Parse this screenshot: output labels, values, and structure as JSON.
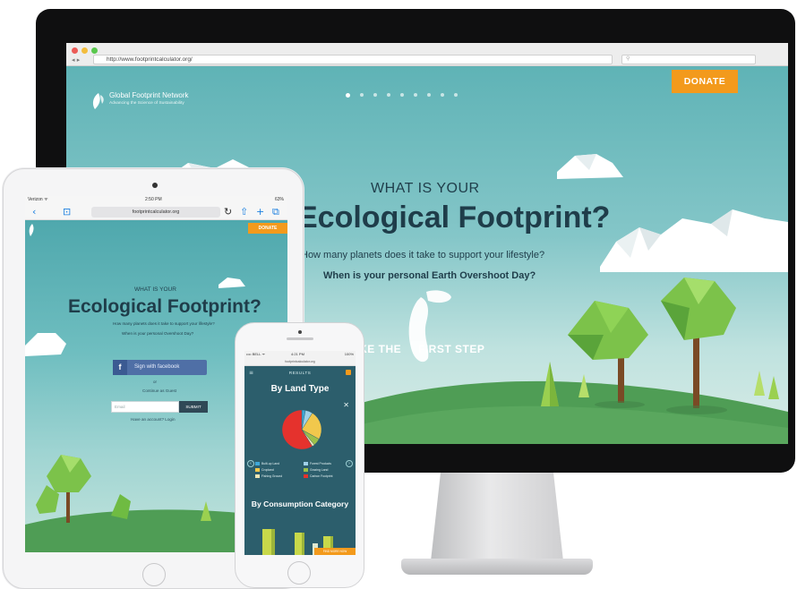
{
  "monitor": {
    "browser": {
      "url": "http://www.footprintcalculator.org/",
      "back_icon": "◂",
      "forward_icon": "▸"
    },
    "page": {
      "donate_label": "DONATE",
      "logo": {
        "name": "Global Footprint Network",
        "tagline": "Advancing the Science of Sustainability"
      },
      "pager": {
        "count": 9,
        "active": 0
      },
      "heading_small": "WHAT IS YOUR",
      "heading_big": "Ecological Footprint?",
      "question_1": "How many planets does it take to support your lifestyle?",
      "question_2": "When is your personal Earth Overshoot Day?",
      "cta_left": "TAKE THE",
      "cta_right": "FIRST STEP"
    }
  },
  "tablet": {
    "status": {
      "carrier": "Verizon ᯤ",
      "time": "2:50 PM",
      "battery": "63%"
    },
    "url": "footprintcalculator.org",
    "icons": {
      "back": "‹",
      "book": "⊡",
      "reload": "↻",
      "share": "⇧",
      "add": "+",
      "tabs": "⧉"
    },
    "page": {
      "donate_label": "DONATE",
      "heading_small": "WHAT IS YOUR",
      "heading_big": "Ecological Footprint?",
      "question_1": "How many planets does it take to support your lifestyle?",
      "question_2": "When is your personal Overshoot Day?",
      "facebook_label": "Sign with facebook",
      "facebook_icon": "f",
      "or_label": "or",
      "continue_label": "Continue as Guest",
      "email_placeholder": "Email",
      "submit_label": "SUBMIT",
      "have_account": "Have an account? Login"
    }
  },
  "phone": {
    "status": {
      "carrier": "•••• BELL ᯤ",
      "time": "4:21 PM",
      "battery": "100%"
    },
    "url": "footprintcalculator.org",
    "results_label": "RESULTS",
    "close_icon": "✕",
    "title_1": "By Land Type",
    "title_2": "By Consumption Category",
    "arrow_left": "‹",
    "arrow_right": "›",
    "cta_button": "FIND MORE NOW",
    "pie": [
      {
        "name": "Built-up Land",
        "value": 3,
        "color": "#3fa8d8"
      },
      {
        "name": "Forest Products",
        "value": 6,
        "color": "#9fd0e8"
      },
      {
        "name": "Cropland",
        "value": 24,
        "color": "#f1c84c"
      },
      {
        "name": "Grazing Land",
        "value": 6,
        "color": "#9cc04a"
      },
      {
        "name": "Fishing Ground",
        "value": 2,
        "color": "#f0e7b5"
      },
      {
        "name": "Carbon Footprint",
        "value": 59,
        "color": "#e5322d"
      }
    ],
    "legend": [
      {
        "label": "Built-up Land",
        "color": "#3fa8d8"
      },
      {
        "label": "Forest Products",
        "color": "#9fd0e8"
      },
      {
        "label": "Cropland",
        "color": "#f1c84c"
      },
      {
        "label": "Grazing Land",
        "color": "#9cc04a"
      },
      {
        "label": "Fishing Ground",
        "color": "#f0e7b5"
      },
      {
        "label": "Carbon Footprint",
        "color": "#e5322d"
      }
    ]
  },
  "colors": {
    "accent": "#f39a1c",
    "heading": "#1f3d4a",
    "sky": "#84c6c8",
    "grass": "#4f9d55"
  }
}
